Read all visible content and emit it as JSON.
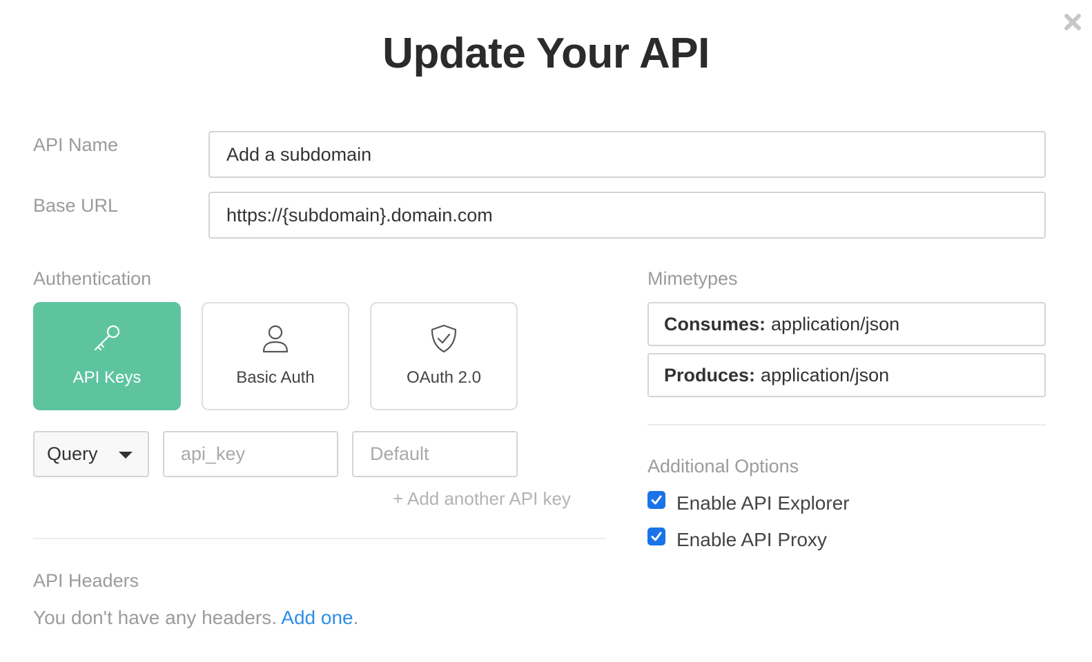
{
  "dialog": {
    "title": "Update Your API",
    "close_icon": "close-icon"
  },
  "api_name": {
    "label": "API Name",
    "value": "Add a subdomain"
  },
  "base_url": {
    "label": "Base URL",
    "value": "https://{subdomain}.domain.com"
  },
  "authentication": {
    "label": "Authentication",
    "options": [
      {
        "label": "API Keys",
        "icon": "key-icon",
        "selected": true
      },
      {
        "label": "Basic Auth",
        "icon": "user-icon",
        "selected": false
      },
      {
        "label": "OAuth 2.0",
        "icon": "shield-check-icon",
        "selected": false
      }
    ],
    "location_select": "Query",
    "key_name_placeholder": "api_key",
    "default_placeholder": "Default",
    "add_another": "+ Add another API key"
  },
  "mimetypes": {
    "label": "Mimetypes",
    "consumes_label": "Consumes:",
    "consumes_value": "application/json",
    "produces_label": "Produces:",
    "produces_value": "application/json"
  },
  "additional_options": {
    "label": "Additional Options",
    "explorer": {
      "label": "Enable API Explorer",
      "checked": true
    },
    "proxy": {
      "label": "Enable API Proxy",
      "checked": true
    }
  },
  "api_headers": {
    "label": "API Headers",
    "empty_text": "You don't have any headers.",
    "add_link": "Add one",
    "trailing": "."
  },
  "colors": {
    "accent": "#5ec4a0",
    "checkbox": "#1a73e8",
    "link": "#2d8ee8"
  }
}
